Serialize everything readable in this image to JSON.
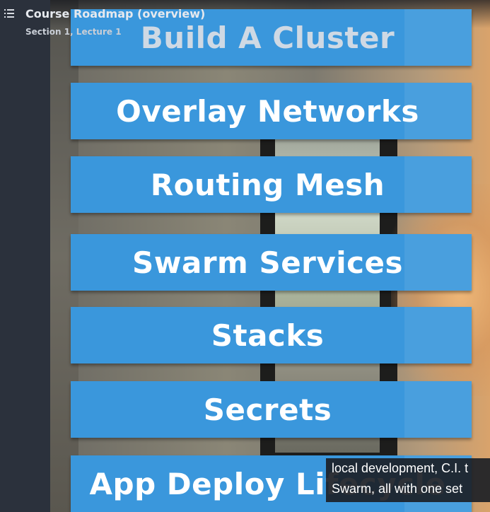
{
  "header": {
    "title": "Course Roadmap (overview)",
    "subtitle": "Section 1, Lecture 1",
    "menu_icon": "list-icon"
  },
  "video": {
    "slide_items": [
      "Build A Cluster",
      "Overlay Networks",
      "Routing Mesh",
      "Swarm Services",
      "Stacks",
      "Secrets",
      "App Deploy Lifecycle"
    ],
    "banner_color": "#3a97dc",
    "caption_lines": [
      "local development, C.I. t",
      "Swarm, all with one set"
    ]
  },
  "colors": {
    "sidebar": "#2b313c",
    "caption_bg": "#1c2026"
  }
}
